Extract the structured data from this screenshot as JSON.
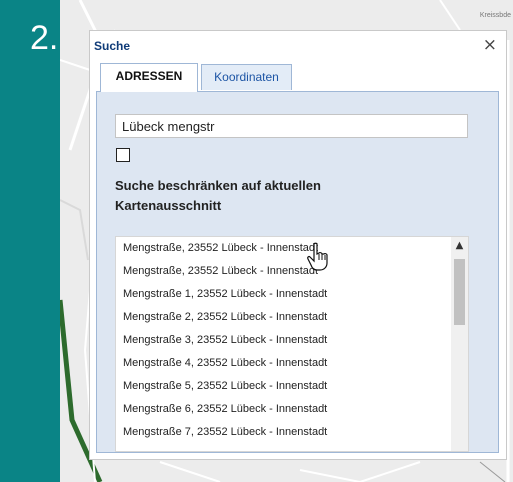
{
  "step_label": "2.",
  "map": {
    "corner_label": "Kreissbde"
  },
  "dialog": {
    "title": "Suche",
    "close_icon": "close-icon",
    "tabs": [
      {
        "label": "ADRESSEN",
        "active": true
      },
      {
        "label": "Koordinaten",
        "active": false
      }
    ],
    "search": {
      "value": "Lübeck mengstr"
    },
    "restrict_checkbox": {
      "checked": false
    },
    "restrict_label": "Suche beschränken auf aktuellen Kartenausschnitt",
    "results": [
      "Mengstraße, 23552 Lübeck - Innenstadt",
      "Mengstraße, 23552 Lübeck - Innenstadt",
      "Mengstraße 1, 23552 Lübeck - Innenstadt",
      "Mengstraße 2, 23552 Lübeck - Innenstadt",
      "Mengstraße 3, 23552 Lübeck - Innenstadt",
      "Mengstraße 4, 23552 Lübeck - Innenstadt",
      "Mengstraße 5, 23552 Lübeck - Innenstadt",
      "Mengstraße 6, 23552 Lübeck - Innenstadt",
      "Mengstraße 7, 23552 Lübeck - Innenstadt"
    ]
  },
  "colors": {
    "background": "#0a8486",
    "title": "#0f3b78",
    "panel": "#dde6f2",
    "tab_inactive_text": "#1d55a5"
  }
}
